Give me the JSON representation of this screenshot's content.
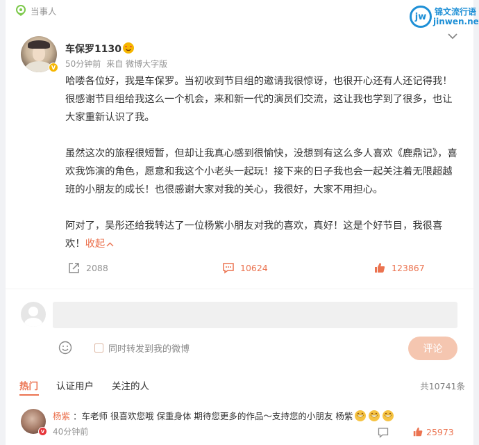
{
  "header": {
    "label": "当事人",
    "pin_icon": "location-pin-icon"
  },
  "watermark": {
    "logo": "jw",
    "line1": "锦文流行语",
    "line2": "jinwen.net"
  },
  "post": {
    "username": "车保罗1130",
    "time": "50分钟前",
    "source": "来自 微博大字版",
    "paragraphs": [
      "哈喽各位好，我是车保罗。当初收到节目组的邀请我很惊讶，也很开心还有人还记得我！很感谢节目组给我这么一个机会，来和新一代的演员们交流，这让我也学到了很多，也让大家重新认识了我。",
      "虽然这次的旅程很短暂，但却让我真心感到很愉快，没想到有这么多人喜欢《鹿鼎记》，喜欢我饰演的角色，愿意和我这个小老头一起玩！接下来的日子我也会一起关注着无限超越班的小朋友的成长！也很感谢大家对我的关心，我很好，大家不用担心。"
    ],
    "last_paragraph": "阿对了，吴彤还给我转达了一位杨紫小朋友对我的喜欢，真好！这是个好节目，我很喜欢！",
    "collapse_label": "收起",
    "repost_count": "2088",
    "comment_count": "10624",
    "like_count": "123867"
  },
  "composer": {
    "placeholder": "",
    "repost_label": "同时转发到我的微博",
    "submit_label": "评论"
  },
  "tabs": [
    {
      "label": "热门",
      "active": true
    },
    {
      "label": "认证用户",
      "active": false
    },
    {
      "label": "关注的人",
      "active": false
    }
  ],
  "total_comments": "共10741条",
  "reply": {
    "author": "杨紫",
    "text": "：车老师 很喜欢您哦 保重身体 期待您更多的作品～支持您的小朋友 杨紫",
    "time": "40分钟前",
    "like_count": "25973"
  },
  "colors": {
    "accent": "#eb7350",
    "muted": "#939393",
    "verified": "#f6b600"
  }
}
